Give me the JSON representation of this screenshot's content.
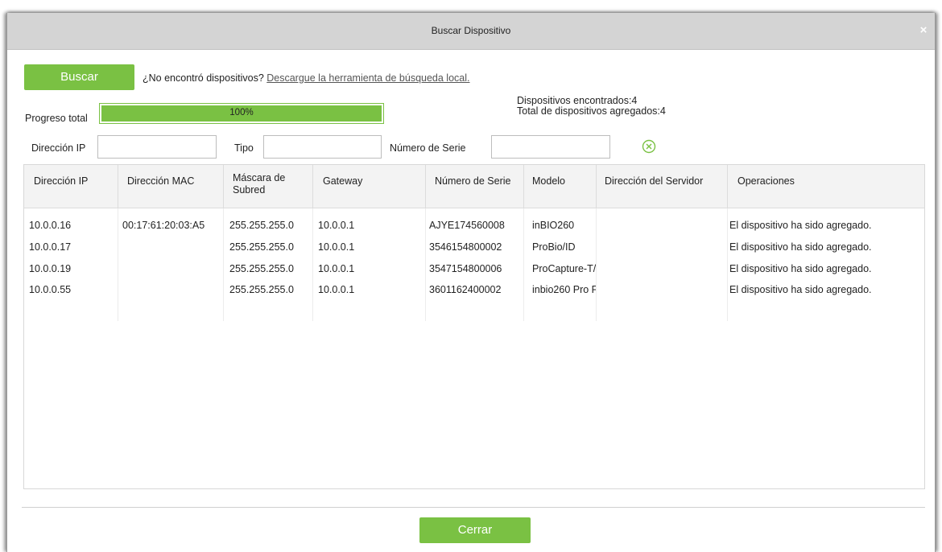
{
  "dialog": {
    "title": "Buscar Dispositivo",
    "close_icon": "×"
  },
  "search": {
    "button_label": "Buscar",
    "hint_text": "¿No encontró dispositivos? ",
    "hint_link": "Descargue la herramienta de búsqueda local."
  },
  "progress": {
    "label": "Progreso total",
    "percent_text": "100%",
    "value": 1.0
  },
  "stats": {
    "found": "Dispositivos encontrados:4",
    "added": "Total de dispositivos agregados:4"
  },
  "filters": {
    "ip_label": "Dirección IP",
    "ip_value": "",
    "type_label": "Tipo",
    "type_value": "",
    "serial_label": "Número de Serie",
    "serial_value": "",
    "clear_icon": "clear-circle-x-icon"
  },
  "table": {
    "columns": [
      {
        "label": "Dirección IP"
      },
      {
        "label": "Dirección MAC"
      },
      {
        "label": "Máscara de Subred"
      },
      {
        "label": "Gateway"
      },
      {
        "label": "Número de Serie"
      },
      {
        "label": "Modelo"
      },
      {
        "label": "Dirección del Servidor"
      },
      {
        "label": "Operaciones"
      }
    ],
    "rows": [
      [
        "10.0.0.16",
        "00:17:61:20:03:A5",
        "255.255.255.0",
        "10.0.0.1",
        "AJYE174560008",
        "inBIO260",
        "",
        "El dispositivo ha sido agregado."
      ],
      [
        "10.0.0.17",
        "",
        "255.255.255.0",
        "10.0.0.1",
        "3546154800002",
        "ProBio/ID",
        "",
        "El dispositivo ha sido agregado."
      ],
      [
        "10.0.0.19",
        "",
        "255.255.255.0",
        "10.0.0.1",
        "3547154800006",
        "ProCapture-T/",
        "",
        "El dispositivo ha sido agregado."
      ],
      [
        "10.0.0.55",
        "",
        "255.255.255.0",
        "10.0.0.1",
        "3601162400002",
        "inbio260 Pro F",
        "",
        "El dispositivo ha sido agregado."
      ]
    ]
  },
  "footer": {
    "close_label": "Cerrar"
  },
  "colors": {
    "accent_green": "#7ac143",
    "titlebar": "#d4d4d4",
    "header_bg": "#f3f3f3"
  }
}
